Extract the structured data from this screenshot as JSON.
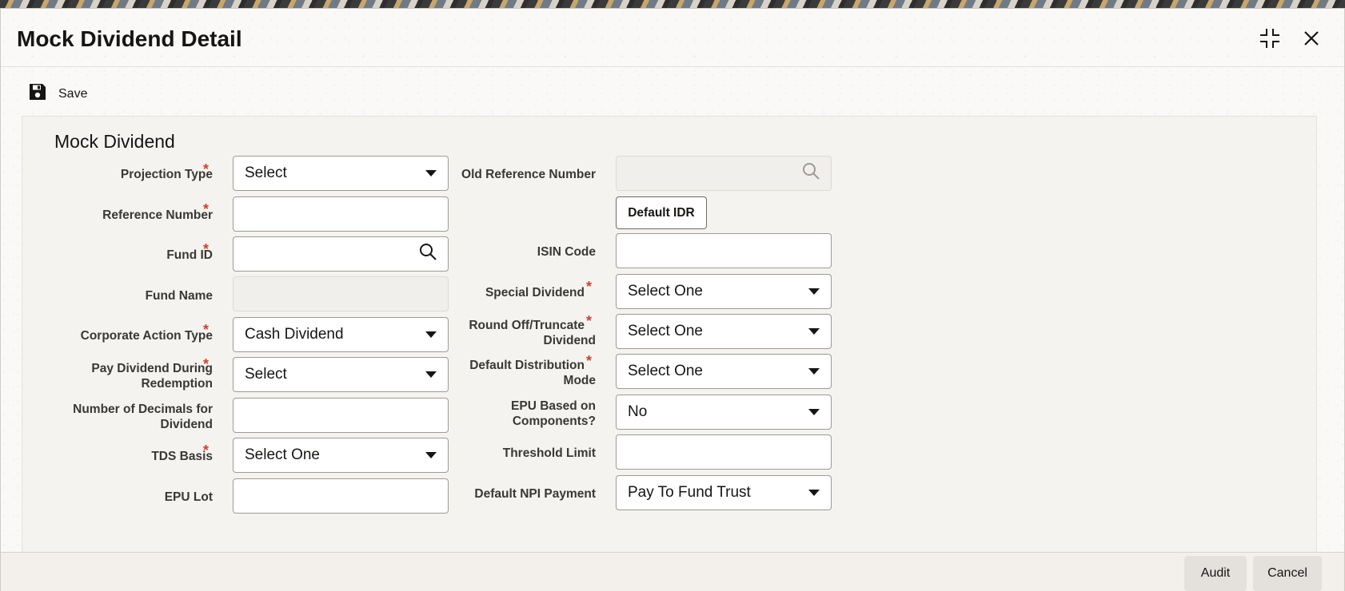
{
  "window": {
    "title": "Mock Dividend Detail"
  },
  "toolbar": {
    "save_label": "Save"
  },
  "section": {
    "title": "Mock Dividend"
  },
  "left_fields": {
    "projection_type": {
      "label": "Projection Type",
      "value": "Select"
    },
    "reference_number": {
      "label": "Reference Number",
      "value": ""
    },
    "fund_id": {
      "label": "Fund ID",
      "value": ""
    },
    "fund_name": {
      "label": "Fund Name",
      "value": ""
    },
    "corporate_action_type": {
      "label": "Corporate Action Type",
      "value": "Cash Dividend"
    },
    "pay_dividend_during_redemption": {
      "label_line1": "Pay Dividend During",
      "label_line2": "Redemption",
      "value": "Select"
    },
    "number_of_decimals": {
      "label_line1": "Number of Decimals for",
      "label_line2": "Dividend",
      "value": ""
    },
    "tds_basis": {
      "label": "TDS Basis",
      "value": "Select One"
    },
    "epu_lot": {
      "label": "EPU Lot",
      "value": ""
    }
  },
  "right_fields": {
    "old_reference_number": {
      "label": "Old Reference Number",
      "value": ""
    },
    "default_idr_button": "Default IDR",
    "isin_code": {
      "label": "ISIN Code",
      "value": ""
    },
    "special_dividend": {
      "label": "Special Dividend",
      "value": "Select One"
    },
    "round_off_truncate": {
      "label_line1": "Round Off/Truncate",
      "label_line2": "Dividend",
      "value": "Select One"
    },
    "default_distribution_mode": {
      "label_line1": "Default Distribution",
      "label_line2": "Mode",
      "value": "Select One"
    },
    "epu_based_on_components": {
      "label_line1": "EPU Based on",
      "label_line2": "Components?",
      "value": "No"
    },
    "threshold_limit": {
      "label": "Threshold Limit",
      "value": ""
    },
    "default_npi_payment": {
      "label": "Default NPI Payment",
      "value": "Pay To Fund Trust"
    }
  },
  "required_marker": "*",
  "footer": {
    "audit_label": "Audit",
    "cancel_label": "Cancel"
  },
  "icons": {
    "maximize": "maximize-icon",
    "close": "close-icon",
    "save": "floppy-disk-icon",
    "search": "search-icon",
    "dropdown": "chevron-down-icon"
  },
  "colors": {
    "required": "#c74634",
    "field_border": "#9e9a94",
    "window_bg": "#fbf9f8"
  }
}
